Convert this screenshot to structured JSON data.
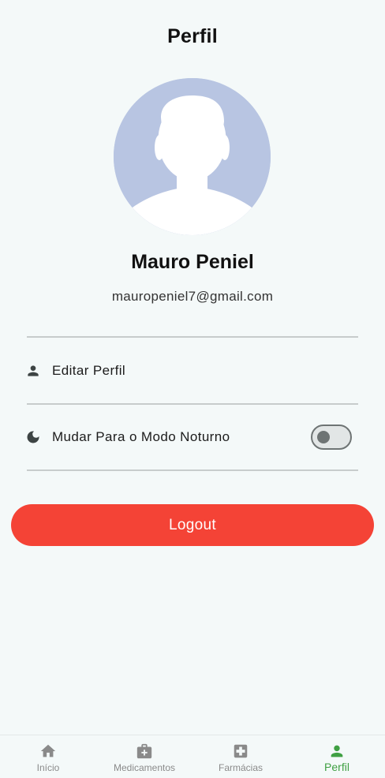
{
  "header": {
    "title": "Perfil"
  },
  "profile": {
    "name": "Mauro Peniel",
    "email": "mauropeniel7@gmail.com"
  },
  "menu": {
    "edit_profile": {
      "label": "Editar Perfil",
      "icon": "person-icon"
    },
    "dark_mode": {
      "label": "Mudar Para o Modo Noturno",
      "icon": "moon-icon",
      "enabled": false
    }
  },
  "actions": {
    "logout_label": "Logout"
  },
  "bottom_nav": {
    "items": [
      {
        "label": "Início",
        "icon": "home-icon",
        "active": false
      },
      {
        "label": "Medicamentos",
        "icon": "medical-bag-icon",
        "active": false
      },
      {
        "label": "Farmácias",
        "icon": "hospital-cross-icon",
        "active": false
      },
      {
        "label": "Perfil",
        "icon": "person-icon",
        "active": true
      }
    ]
  },
  "colors": {
    "background": "#f4f9f9",
    "accent_active": "#3fa043",
    "logout": "#f44336",
    "avatar_bg": "#b8c5e2",
    "icon_gray": "#8a8a8a"
  }
}
